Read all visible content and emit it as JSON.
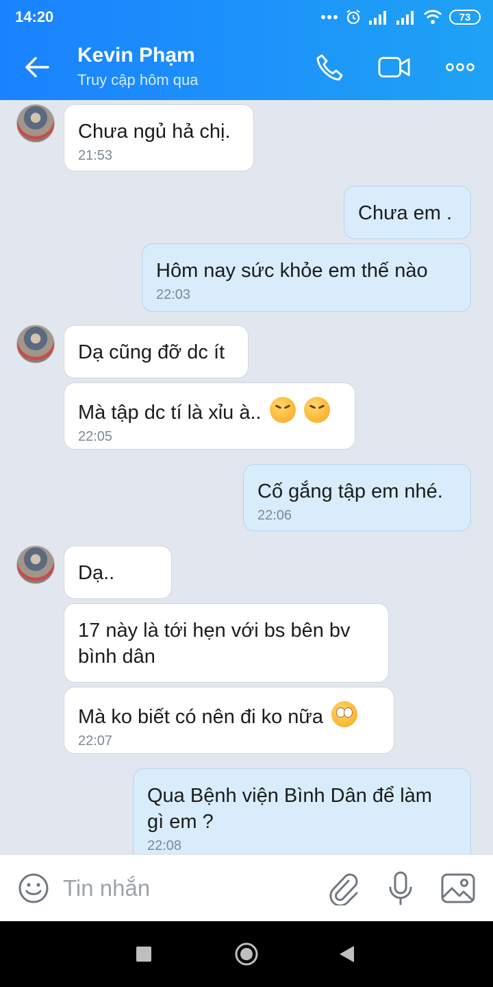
{
  "status_bar": {
    "time": "14:20",
    "battery": "73"
  },
  "header": {
    "contact_name": "Kevin Phạm",
    "contact_status": "Truy cập hôm qua"
  },
  "messages": [
    {
      "direction": "in",
      "text": "Chưa ngủ hả chị.",
      "time": "21:53"
    },
    {
      "direction": "out",
      "text": "Chưa em ."
    },
    {
      "direction": "out",
      "text": "Hôm nay sức khỏe em thế nào",
      "time": "22:03"
    },
    {
      "direction": "in",
      "text": "Dạ cũng đỡ dc ít"
    },
    {
      "direction": "in",
      "text": "Mà tập dc tí là xỉu à..",
      "emojis": [
        "angry-face-icon",
        "angry-face-icon"
      ],
      "time": "22:05"
    },
    {
      "direction": "out",
      "text": "Cố gắng tập em nhé.",
      "time": "22:06"
    },
    {
      "direction": "in",
      "text": "Dạ.."
    },
    {
      "direction": "in",
      "text_line1": "17 này là tới hẹn với bs bên bv",
      "text_line2": "bình dân"
    },
    {
      "direction": "in",
      "text": "Mà ko biết có nên đi ko nữa",
      "emojis": [
        "eye-roll-face-icon"
      ],
      "time": "22:07"
    },
    {
      "direction": "out",
      "text_line1": "Qua Bệnh viện Bình Dân để làm",
      "text_line2": "gì em ?",
      "time": "22:08"
    }
  ],
  "composer": {
    "placeholder": "Tin nhắn"
  },
  "colors": {
    "header_start": "#1a82ff",
    "header_end": "#1fa2f5",
    "incoming_bubble": "#ffffff",
    "outgoing_bubble": "#d8ecfb",
    "chat_background": "#e2e7ef"
  }
}
